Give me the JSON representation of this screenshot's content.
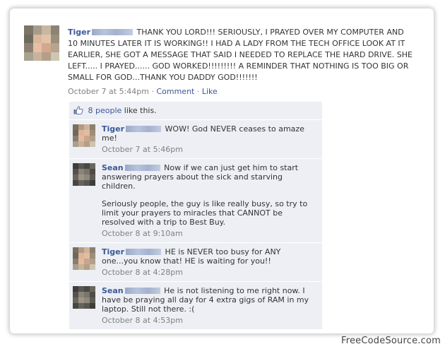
{
  "post": {
    "author": "Tiger",
    "text": "THANK YOU LORD!!! SERIOUSLY, I PRAYED OVER MY COMPUTER AND 10 MINUTES LATER IT IS WORKING!! I HAD A LADY FROM THE TECH OFFICE LOOK AT IT EARLIER, SHE GOT A MESSAGE THAT SAID I NEEDED TO REPLACE THE HARD DRIVE. SHE LEFT..... I PRAYED...... GOD WORKED!!!!!!!!! A REMINDER THAT NOTHING IS TOO BIG OR SMALL FOR GOD...THANK YOU DADDY GOD!!!!!!!",
    "timestamp": "October 7 at 5:44pm",
    "separator": "·",
    "comment_link": "Comment",
    "like_link": "Like"
  },
  "likes": {
    "count_link": "8 people",
    "suffix": "like this."
  },
  "comments": [
    {
      "author": "Tiger",
      "text": "WOW! God NEVER ceases to amaze me!",
      "timestamp": "October 7 at 5:46pm"
    },
    {
      "author": "Sean",
      "text": "Now if we can just get him to start answering prayers about the sick and starving children.",
      "text2": "Seriously people, the guy is like really busy, so try to limit your prayers to miracles that CANNOT be resolved with a trip to Best Buy.",
      "timestamp": "October 8 at 9:10am"
    },
    {
      "author": "Tiger",
      "text": "HE is NEVER too busy for ANY one...you know that! HE is waiting for you!!",
      "timestamp": "October 8 at 4:28pm"
    },
    {
      "author": "Sean",
      "text": "He is not listening to me right now. I have be praying all day for 4 extra gigs of RAM in my laptop. Still not there. :(",
      "timestamp": "October 8 at 4:53pm"
    }
  ],
  "watermark": "FreeCodeSource.com",
  "colors": {
    "link": "#3b5998",
    "timestamp": "#808080",
    "comment_bg": "#edeff4"
  }
}
